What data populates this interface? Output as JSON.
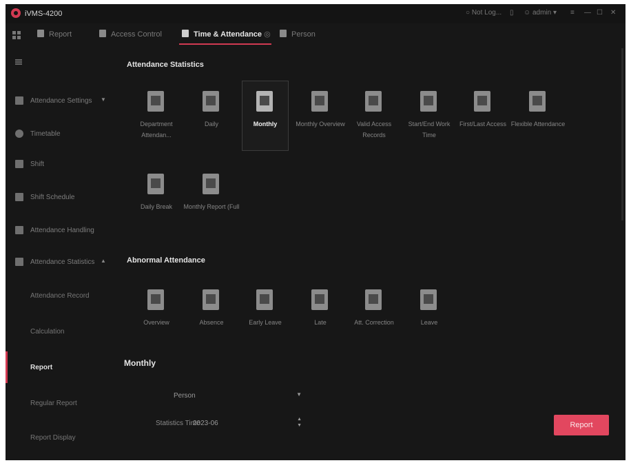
{
  "app": {
    "title": "iVMS-4200"
  },
  "titlebar": {
    "login": "Not Log...",
    "user": "admin"
  },
  "nav": {
    "tabs": [
      {
        "label": "Report"
      },
      {
        "label": "Access Control"
      },
      {
        "label": "Time & Attendance"
      },
      {
        "label": "Person"
      }
    ]
  },
  "sidebar": {
    "items": [
      {
        "label": "Attendance Settings",
        "icon": "settings-icon"
      },
      {
        "label": "Timetable",
        "icon": "clock-icon"
      },
      {
        "label": "Shift",
        "icon": "calendar-icon"
      },
      {
        "label": "Shift Schedule",
        "icon": "schedule-icon"
      },
      {
        "label": "Attendance Handling",
        "icon": "handling-icon"
      },
      {
        "label": "Attendance Statistics",
        "icon": "statistics-icon"
      }
    ],
    "subitems": [
      {
        "label": "Attendance Record"
      },
      {
        "label": "Calculation"
      },
      {
        "label": "Report"
      },
      {
        "label": "Regular Report"
      },
      {
        "label": "Report Display"
      }
    ]
  },
  "main": {
    "stats_title": "Attendance Statistics",
    "stats_tiles": [
      {
        "label": "Department Attendan...",
        "icon": "department-report-icon"
      },
      {
        "label": "Daily",
        "icon": "daily-report-icon"
      },
      {
        "label": "Monthly",
        "icon": "monthly-report-icon"
      },
      {
        "label": "Monthly Overview",
        "icon": "monthly-overview-icon"
      },
      {
        "label": "Valid Access Records",
        "icon": "access-records-icon"
      },
      {
        "label": "Start/End Work Time",
        "icon": "work-time-icon"
      },
      {
        "label": "First/Last Access",
        "icon": "first-last-access-icon"
      },
      {
        "label": "Flexible Attendance",
        "icon": "flexible-attendance-icon"
      },
      {
        "label": "Daily Break",
        "icon": "daily-break-icon"
      },
      {
        "label": "Monthly Report (Full",
        "icon": "monthly-full-report-icon"
      }
    ],
    "abnormal_title": "Abnormal Attendance",
    "abnormal_tiles": [
      {
        "label": "Overview",
        "icon": "overview-icon"
      },
      {
        "label": "Absence",
        "icon": "absence-icon"
      },
      {
        "label": "Early Leave",
        "icon": "early-leave-icon"
      },
      {
        "label": "Late",
        "icon": "late-icon"
      },
      {
        "label": "Att. Correction",
        "icon": "correction-icon"
      },
      {
        "label": "Leave",
        "icon": "leave-icon"
      }
    ],
    "form_title": "Monthly",
    "person_value": "Person",
    "statistics_time_label": "Statistics Time",
    "statistics_time_value": "2023-06",
    "report_button": "Report"
  },
  "colors": {
    "accent": "#e2475f",
    "background": "#171717"
  }
}
